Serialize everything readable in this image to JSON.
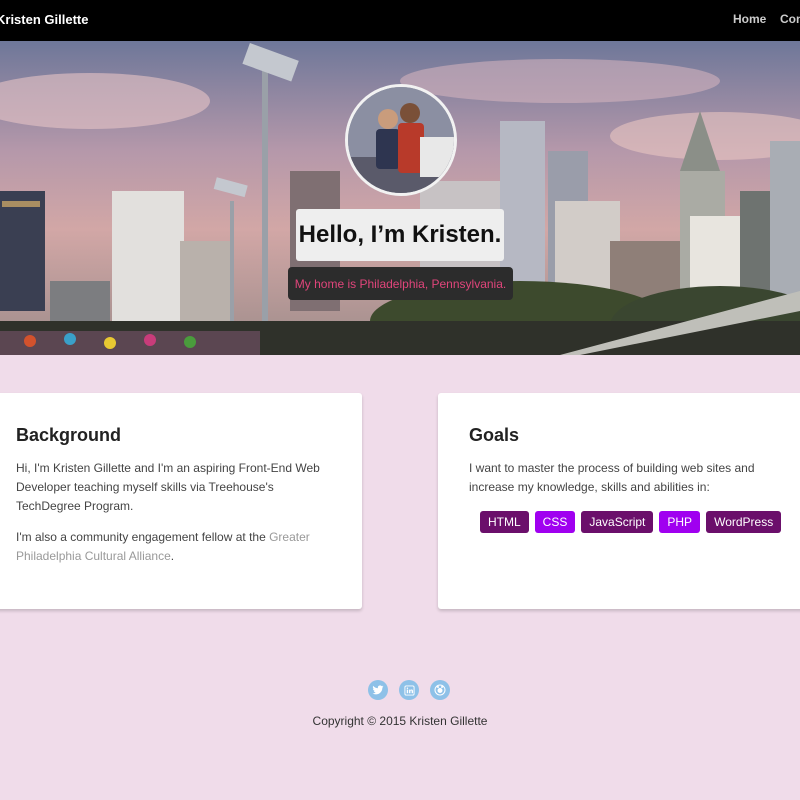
{
  "nav": {
    "brand": "Kristen Gillette",
    "links": [
      "Home",
      "Contact"
    ]
  },
  "hero": {
    "title": "Hello, I’m Kristen.",
    "subtitle": "My home is Philadelphia, Pennsylvania.",
    "subtitle_color": "#e0457b"
  },
  "background": {
    "heading": "Background",
    "p1": "Hi, I'm Kristen Gillette and I'm an aspiring Front-End Web Developer teaching myself skills via Treehouse's TechDegree Program.",
    "p2_prefix": "I'm also a community engagement fellow at the ",
    "p2_link": "Greater Philadelphia Cultural Alliance",
    "p2_suffix": "."
  },
  "goals": {
    "heading": "Goals",
    "text": "I want to master the process of building web sites and increase my knowledge, skills and abilities in:",
    "tags": [
      {
        "label": "HTML",
        "color": "#6b0f6b"
      },
      {
        "label": "CSS",
        "color": "#a000f0"
      },
      {
        "label": "JavaScript",
        "color": "#6b0f6b"
      },
      {
        "label": "PHP",
        "color": "#a000f0"
      },
      {
        "label": "WordPress",
        "color": "#6b0f6b"
      }
    ]
  },
  "footer": {
    "social": [
      {
        "icon": "twitter-icon",
        "glyph": "🐦"
      },
      {
        "icon": "linkedin-icon",
        "glyph": "in"
      },
      {
        "icon": "github-icon",
        "glyph": "●"
      }
    ],
    "copyright": "Copyright © 2015 Kristen Gillette"
  },
  "colors": {
    "page_bg": "#f0dcea",
    "nav_bg": "#000000",
    "social_icon": "#8ec1e8"
  }
}
